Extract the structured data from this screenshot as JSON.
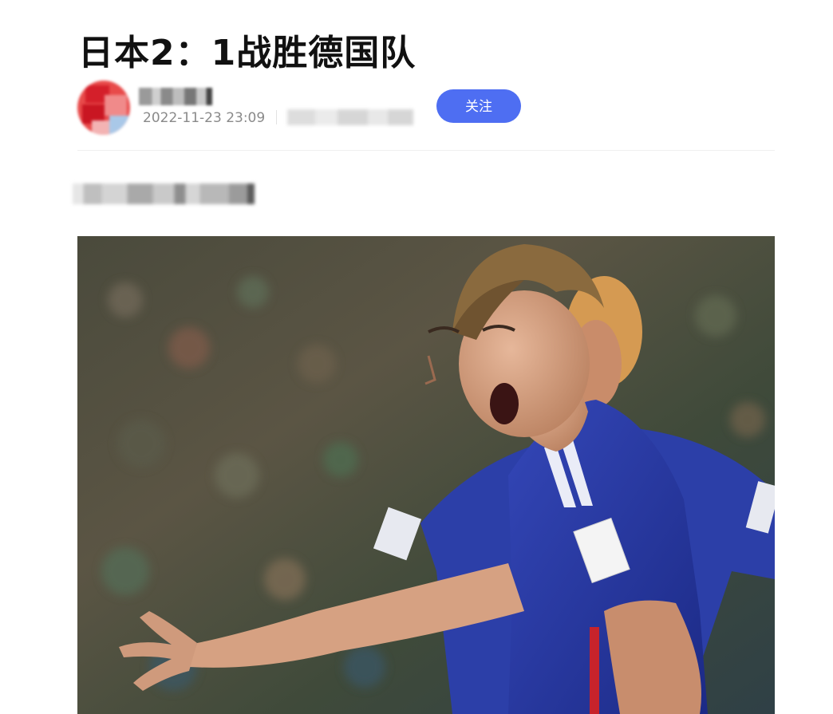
{
  "article": {
    "title": "日本2：1战胜德国队",
    "publish_time": "2022-11-23 23:09"
  },
  "author": {
    "follow_label": "关注"
  },
  "icons": {
    "avatar": "avatar-image",
    "photo": "article-photo"
  },
  "colors": {
    "accent": "#4e6ef2",
    "title_text": "#111111",
    "meta_text": "#8a8a8a"
  }
}
